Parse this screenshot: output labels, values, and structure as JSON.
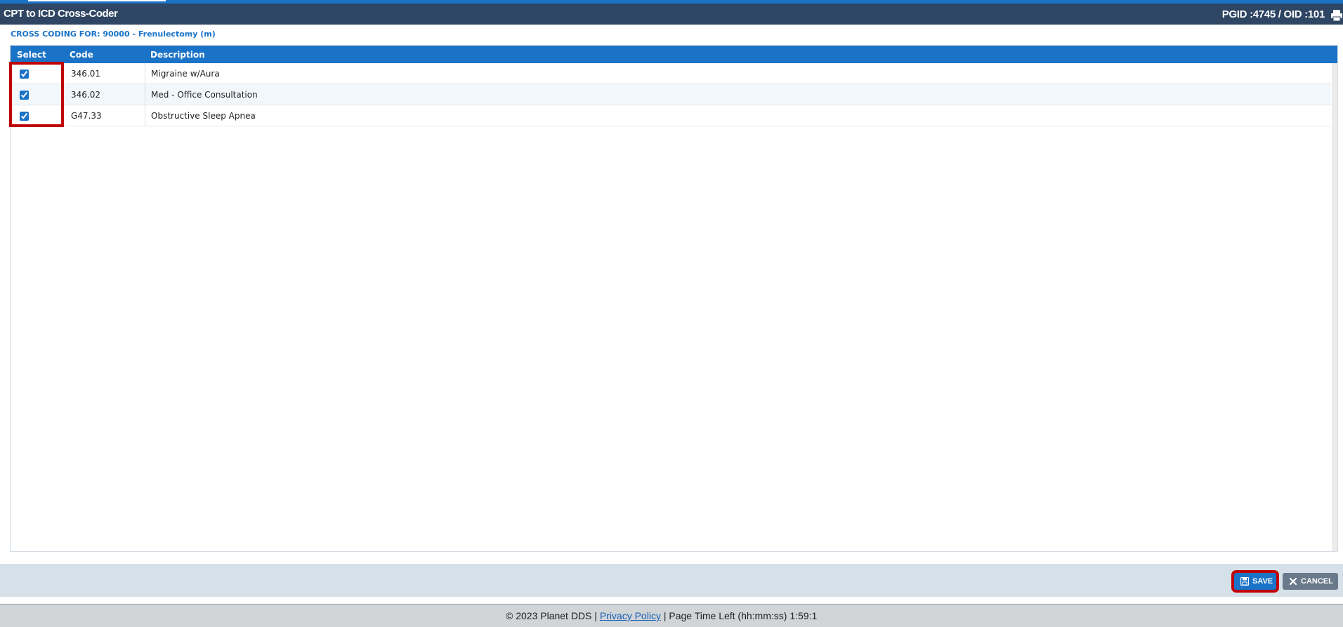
{
  "window": {
    "title": "CPT to ICD Cross-Coder",
    "ids_text": "PGID :4745  /  OID :101",
    "print_icon": "printer-icon"
  },
  "cross_coding": {
    "heading": "CROSS CODING FOR: 90000 - Frenulectomy (m)"
  },
  "grid": {
    "columns": [
      "Select",
      "Code",
      "Description"
    ],
    "rows": [
      {
        "checked": true,
        "code": "346.01",
        "description": "Migraine w/Aura"
      },
      {
        "checked": true,
        "code": "346.02",
        "description": "Med - Office Consultation"
      },
      {
        "checked": true,
        "code": "G47.33",
        "description": "Obstructive Sleep Apnea"
      }
    ]
  },
  "actions": {
    "save_label": "SAVE",
    "save_icon": "floppy-disk-icon",
    "cancel_label": "CANCEL",
    "cancel_icon": "close-icon"
  },
  "status": {
    "copyright": "© 2023 Planet DDS |",
    "privacy_link": "Privacy Policy",
    "separator": "|",
    "time_left": "Page Time Left (hh:mm:ss) 1:59:1"
  },
  "colors": {
    "accent": "#1a73c7",
    "title_bar": "#2e4563",
    "highlight": "#c00000"
  }
}
